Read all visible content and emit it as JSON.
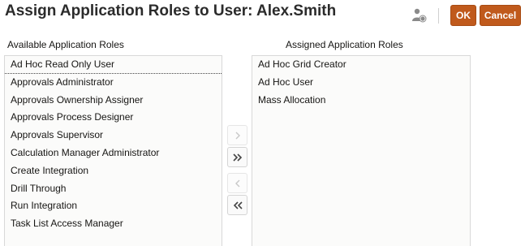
{
  "header": {
    "title": "Assign Application Roles to User: Alex.Smith",
    "ok_label": "OK",
    "cancel_label": "Cancel",
    "icon": "user-role-icon"
  },
  "available": {
    "label": "Available Application Roles",
    "items": [
      "Ad Hoc Read Only User",
      "Approvals Administrator",
      "Approvals Ownership Assigner",
      "Approvals Process Designer",
      "Approvals Supervisor",
      "Calculation Manager Administrator",
      "Create Integration",
      "Drill Through",
      "Run Integration",
      "Task List Access Manager"
    ]
  },
  "assigned": {
    "label": "Assigned Application Roles",
    "items": [
      "Ad Hoc Grid Creator",
      "Ad Hoc User",
      "Mass Allocation"
    ]
  },
  "shuttle": {
    "move_selected_icon": "chevron-right-icon",
    "move_all_icon": "double-chevron-right-icon",
    "remove_selected_icon": "chevron-left-icon",
    "remove_all_icon": "double-chevron-left-icon"
  },
  "colors": {
    "accent": "#c05a1c",
    "list_background": "#fbfbfa",
    "border": "#d8d8d8"
  }
}
